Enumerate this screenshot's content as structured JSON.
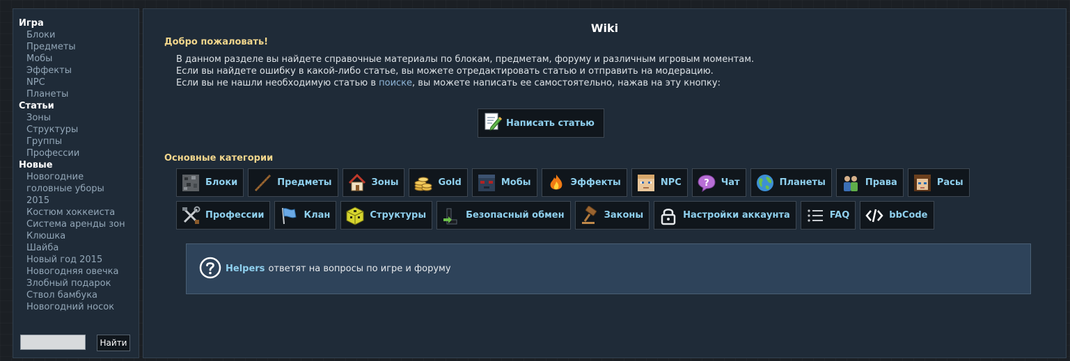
{
  "sidebar": {
    "sections": [
      {
        "title": "Игра",
        "items": [
          "Блоки",
          "Предметы",
          "Мобы",
          "Эффекты",
          "NPC",
          "Планеты"
        ]
      },
      {
        "title": "Статьи",
        "items": [
          "Зоны",
          "Структуры",
          "Группы",
          "Профессии"
        ]
      },
      {
        "title": "Новые",
        "items": [
          "Новогодние",
          "головные уборы",
          "2015",
          "Костюм хоккеиста",
          "Система аренды зон",
          "Клюшка",
          "Шайба",
          "Новый год 2015",
          "Новогодняя овечка",
          "Злобный подарок",
          "Ствол бамбука",
          "Новогодний носок"
        ]
      }
    ],
    "search": {
      "value": "",
      "button_label": "Найти"
    }
  },
  "main": {
    "title": "Wiki",
    "welcome": "Добро пожаловать!",
    "intro": [
      "В данном разделе вы найдете справочные материалы по блокам, предметам, форуму и различным игровым моментам.",
      "Если вы найдете ошибку в какой-либо статье, вы можете отредактировать статью и отправить на модерацию."
    ],
    "intro3_before": "Если вы не нашли необходимую статью в ",
    "intro3_link": "поиске",
    "intro3_after": ", вы можете написать ее самостоятельно, нажав на эту кнопку:",
    "write_button": "Написать статью",
    "categories_title": "Основные категории",
    "categories_row1": [
      {
        "label": "Блоки",
        "icon": "ore-block-icon"
      },
      {
        "label": "Предметы",
        "icon": "stick-icon"
      },
      {
        "label": "Зоны",
        "icon": "house-icon"
      },
      {
        "label": "Gold",
        "icon": "coins-icon"
      },
      {
        "label": "Мобы",
        "icon": "mob-face-icon"
      },
      {
        "label": "Эффекты",
        "icon": "fire-icon"
      },
      {
        "label": "NPC",
        "icon": "npc-face-icon"
      },
      {
        "label": "Чат",
        "icon": "chat-bubble-icon"
      },
      {
        "label": "Планеты",
        "icon": "globe-icon"
      },
      {
        "label": "Права",
        "icon": "users-icon"
      },
      {
        "label": "Расы",
        "icon": "race-face-icon"
      }
    ],
    "categories_row2": [
      {
        "label": "Профессии",
        "icon": "tools-icon"
      },
      {
        "label": "Клан",
        "icon": "flag-icon"
      },
      {
        "label": "Структуры",
        "icon": "structure-block-icon"
      },
      {
        "label": "Безопасный обмен",
        "icon": "trade-icon"
      },
      {
        "label": "Законы",
        "icon": "gavel-icon"
      },
      {
        "label": "Настройки аккаунта",
        "icon": "lock-icon"
      },
      {
        "label": "FAQ",
        "icon": "list-icon"
      },
      {
        "label": "bbCode",
        "icon": "code-icon"
      }
    ],
    "helpers": {
      "link": "Helpers",
      "text": "ответят на вопросы по игре и форуму"
    }
  }
}
